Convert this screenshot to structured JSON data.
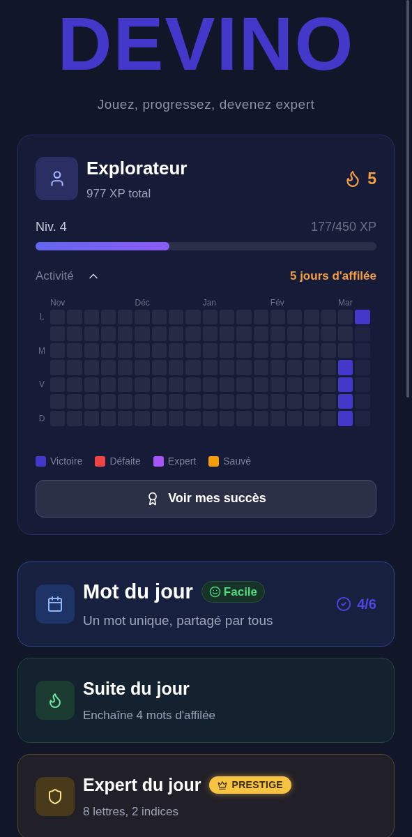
{
  "logo": "DEVINO",
  "tagline": "Jouez, progressez, devenez expert",
  "profile": {
    "title": "Explorateur",
    "xp_total": "977 XP total",
    "streak": "5",
    "level_label": "Niv. 4",
    "xp_progress": "177/450 XP",
    "level": 0.393,
    "activity": {
      "label": "Activité",
      "expanded": true,
      "streak_text": "5 jours d'affilée",
      "day_labels": [
        "L",
        "M",
        "V",
        "D"
      ],
      "weeks": [
        {
          "month": "Nov",
          "days": [
            {
              "kind": "empty"
            },
            {
              "kind": "empty"
            },
            {
              "kind": "empty"
            },
            {
              "kind": "empty"
            },
            {
              "kind": "empty"
            },
            {
              "kind": "empty"
            },
            {
              "kind": "empty"
            }
          ]
        },
        {
          "days": [
            {
              "kind": "empty"
            },
            {
              "kind": "empty"
            },
            {
              "kind": "empty"
            },
            {
              "kind": "empty"
            },
            {
              "kind": "empty"
            },
            {
              "kind": "empty"
            },
            {
              "kind": "empty"
            }
          ]
        },
        {
          "days": [
            {
              "kind": "empty"
            },
            {
              "kind": "empty"
            },
            {
              "kind": "empty"
            },
            {
              "kind": "empty"
            },
            {
              "kind": "empty"
            },
            {
              "kind": "empty"
            },
            {
              "kind": "empty"
            }
          ]
        },
        {
          "days": [
            {
              "kind": "empty"
            },
            {
              "kind": "empty"
            },
            {
              "kind": "empty"
            },
            {
              "kind": "empty"
            },
            {
              "kind": "empty"
            },
            {
              "kind": "empty"
            },
            {
              "kind": "empty"
            }
          ]
        },
        {
          "days": [
            {
              "kind": "empty"
            },
            {
              "kind": "empty"
            },
            {
              "kind": "empty"
            },
            {
              "kind": "empty"
            },
            {
              "kind": "empty"
            },
            {
              "kind": "empty"
            },
            {
              "kind": "empty"
            }
          ]
        },
        {
          "month": "Déc",
          "days": [
            {
              "kind": "empty"
            },
            {
              "kind": "empty"
            },
            {
              "kind": "empty"
            },
            {
              "kind": "empty"
            },
            {
              "kind": "empty"
            },
            {
              "kind": "empty"
            },
            {
              "kind": "empty"
            }
          ]
        },
        {
          "days": [
            {
              "kind": "empty"
            },
            {
              "kind": "empty"
            },
            {
              "kind": "empty"
            },
            {
              "kind": "empty"
            },
            {
              "kind": "empty"
            },
            {
              "kind": "empty"
            },
            {
              "kind": "empty"
            }
          ]
        },
        {
          "days": [
            {
              "kind": "empty"
            },
            {
              "kind": "empty"
            },
            {
              "kind": "empty"
            },
            {
              "kind": "empty"
            },
            {
              "kind": "empty"
            },
            {
              "kind": "empty"
            },
            {
              "kind": "empty"
            }
          ]
        },
        {
          "days": [
            {
              "kind": "empty"
            },
            {
              "kind": "empty"
            },
            {
              "kind": "empty"
            },
            {
              "kind": "empty"
            },
            {
              "kind": "empty"
            },
            {
              "kind": "empty"
            },
            {
              "kind": "empty"
            }
          ]
        },
        {
          "month": "Jan",
          "days": [
            {
              "kind": "empty"
            },
            {
              "kind": "empty"
            },
            {
              "kind": "empty"
            },
            {
              "kind": "empty"
            },
            {
              "kind": "empty"
            },
            {
              "kind": "empty"
            },
            {
              "kind": "empty"
            }
          ]
        },
        {
          "days": [
            {
              "kind": "empty"
            },
            {
              "kind": "empty"
            },
            {
              "kind": "empty"
            },
            {
              "kind": "empty"
            },
            {
              "kind": "empty"
            },
            {
              "kind": "empty"
            },
            {
              "kind": "empty"
            }
          ]
        },
        {
          "days": [
            {
              "kind": "empty"
            },
            {
              "kind": "empty"
            },
            {
              "kind": "empty"
            },
            {
              "kind": "empty"
            },
            {
              "kind": "empty"
            },
            {
              "kind": "empty"
            },
            {
              "kind": "empty"
            }
          ]
        },
        {
          "days": [
            {
              "kind": "empty"
            },
            {
              "kind": "empty"
            },
            {
              "kind": "empty"
            },
            {
              "kind": "empty"
            },
            {
              "kind": "empty"
            },
            {
              "kind": "empty"
            },
            {
              "kind": "empty"
            }
          ]
        },
        {
          "month": "Fév",
          "days": [
            {
              "kind": "empty"
            },
            {
              "kind": "empty"
            },
            {
              "kind": "empty"
            },
            {
              "kind": "empty"
            },
            {
              "kind": "empty"
            },
            {
              "kind": "empty"
            },
            {
              "kind": "empty"
            }
          ]
        },
        {
          "days": [
            {
              "kind": "empty"
            },
            {
              "kind": "empty"
            },
            {
              "kind": "empty"
            },
            {
              "kind": "empty"
            },
            {
              "kind": "empty"
            },
            {
              "kind": "empty"
            },
            {
              "kind": "empty"
            }
          ]
        },
        {
          "days": [
            {
              "kind": "empty"
            },
            {
              "kind": "empty"
            },
            {
              "kind": "empty"
            },
            {
              "kind": "empty"
            },
            {
              "kind": "empty"
            },
            {
              "kind": "empty"
            },
            {
              "kind": "empty"
            }
          ]
        },
        {
          "days": [
            {
              "kind": "empty"
            },
            {
              "kind": "empty"
            },
            {
              "kind": "empty"
            },
            {
              "kind": "empty"
            },
            {
              "kind": "empty"
            },
            {
              "kind": "empty"
            },
            {
              "kind": "empty"
            }
          ]
        },
        {
          "month": "Mar",
          "days": [
            {
              "kind": "empty"
            },
            {
              "kind": "empty"
            },
            {
              "kind": "empty"
            },
            {
              "kind": "win"
            },
            {
              "kind": "win"
            },
            {
              "kind": "win"
            },
            {
              "kind": "win"
            }
          ]
        },
        {
          "days": [
            {
              "kind": "win"
            },
            {
              "kind": "future"
            },
            {
              "kind": "future"
            },
            {
              "kind": "future"
            },
            {
              "kind": "future"
            },
            {
              "kind": "future"
            },
            {
              "kind": "future"
            }
          ]
        }
      ],
      "legend": [
        {
          "label": "Victoire",
          "color": "#4338ca"
        },
        {
          "label": "Défaite",
          "color": "#ef4444"
        },
        {
          "label": "Expert",
          "color": "#a855f7"
        },
        {
          "label": "Sauvé",
          "color": "#f59e0b"
        }
      ]
    },
    "button": "Voir mes succès"
  },
  "games": [
    {
      "kind": "daily",
      "title": "Mot du jour",
      "badge": "Facile",
      "subtitle": "Un mot unique, partagé par tous",
      "score": "4/6"
    },
    {
      "kind": "streak",
      "title": "Suite du jour",
      "subtitle": "Enchaîne 4 mots d'affilée"
    },
    {
      "kind": "expert",
      "title": "Expert du jour",
      "badge": "PRESTIGE",
      "subtitle": "8 lettres, 2 indices"
    }
  ]
}
